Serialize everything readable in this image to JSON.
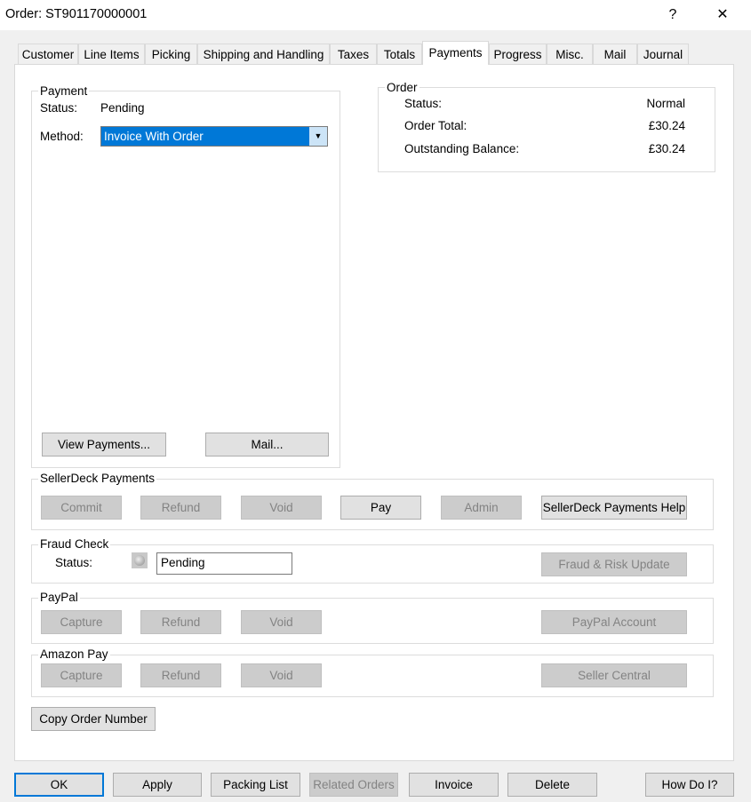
{
  "window": {
    "title": "Order: ST901170000001",
    "help": "?",
    "close": "✕"
  },
  "tabs": [
    "Customer",
    "Line Items",
    "Picking",
    "Shipping and Handling",
    "Taxes",
    "Totals",
    "Payments",
    "Progress",
    "Misc.",
    "Mail",
    "Journal"
  ],
  "selected_tab": "Payments",
  "payment": {
    "group": "Payment",
    "status_label": "Status:",
    "status": "Pending",
    "method_label": "Method:",
    "method": "Invoice With Order",
    "view_payments": "View Payments...",
    "mail": "Mail..."
  },
  "order": {
    "group": "Order",
    "status_label": "Status:",
    "status": "Normal",
    "total_label": "Order Total:",
    "total": "£30.24",
    "balance_label": "Outstanding Balance:",
    "balance": "£30.24"
  },
  "sellerdeck": {
    "group": "SellerDeck Payments",
    "commit": "Commit",
    "refund": "Refund",
    "void": "Void",
    "pay": "Pay",
    "admin": "Admin",
    "help": "SellerDeck Payments Help"
  },
  "fraud": {
    "group": "Fraud Check",
    "status_label": "Status:",
    "status": "Pending",
    "update": "Fraud & Risk Update"
  },
  "paypal": {
    "group": "PayPal",
    "capture": "Capture",
    "refund": "Refund",
    "void": "Void",
    "account": "PayPal Account"
  },
  "amazon": {
    "group": "Amazon Pay",
    "capture": "Capture",
    "refund": "Refund",
    "void": "Void",
    "central": "Seller Central"
  },
  "copy_order_number": "Copy Order Number",
  "footer": {
    "ok": "OK",
    "apply": "Apply",
    "packing_list": "Packing List",
    "related_orders": "Related Orders",
    "invoice": "Invoice",
    "delete": "Delete",
    "how_do_i": "How Do I?"
  },
  "colors": {
    "accent": "#0078d7"
  }
}
